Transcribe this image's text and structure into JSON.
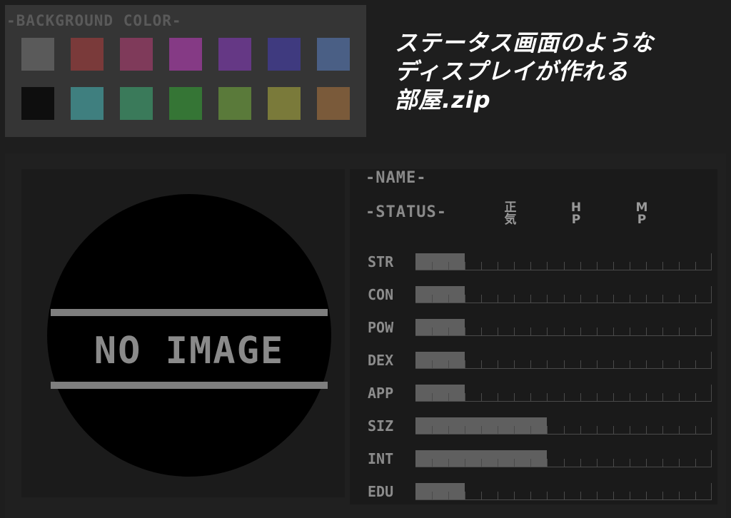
{
  "palette": {
    "title": "-BACKGROUND COLOR-",
    "colors": [
      "#5a5a5a",
      "#7a3a3a",
      "#7f3a5a",
      "#853a85",
      "#653885",
      "#3f3a7f",
      "#4a5f85",
      "#0e0e0e",
      "#3f7f7f",
      "#3a7a5a",
      "#357535",
      "#5a7a3a",
      "#7a7a3a",
      "#7a5a3a"
    ]
  },
  "headline": {
    "line1": "ステータス画面のような",
    "line2": "ディスプレイが作れる",
    "line3": "部屋.zip"
  },
  "portrait": {
    "placeholder": "NO IMAGE"
  },
  "status_panel": {
    "name_label": "-NAME-",
    "status_label": "-STATUS-",
    "vitals": [
      {
        "label": "正気"
      },
      {
        "label": "HP"
      },
      {
        "label": "MP"
      }
    ],
    "stats": [
      {
        "label": "STR",
        "fill": 0.167
      },
      {
        "label": "CON",
        "fill": 0.167
      },
      {
        "label": "POW",
        "fill": 0.167
      },
      {
        "label": "DEX",
        "fill": 0.167
      },
      {
        "label": "APP",
        "fill": 0.167
      },
      {
        "label": "SIZ",
        "fill": 0.444
      },
      {
        "label": "INT",
        "fill": 0.444
      },
      {
        "label": "EDU",
        "fill": 0.167
      }
    ],
    "tick_count": 18
  }
}
